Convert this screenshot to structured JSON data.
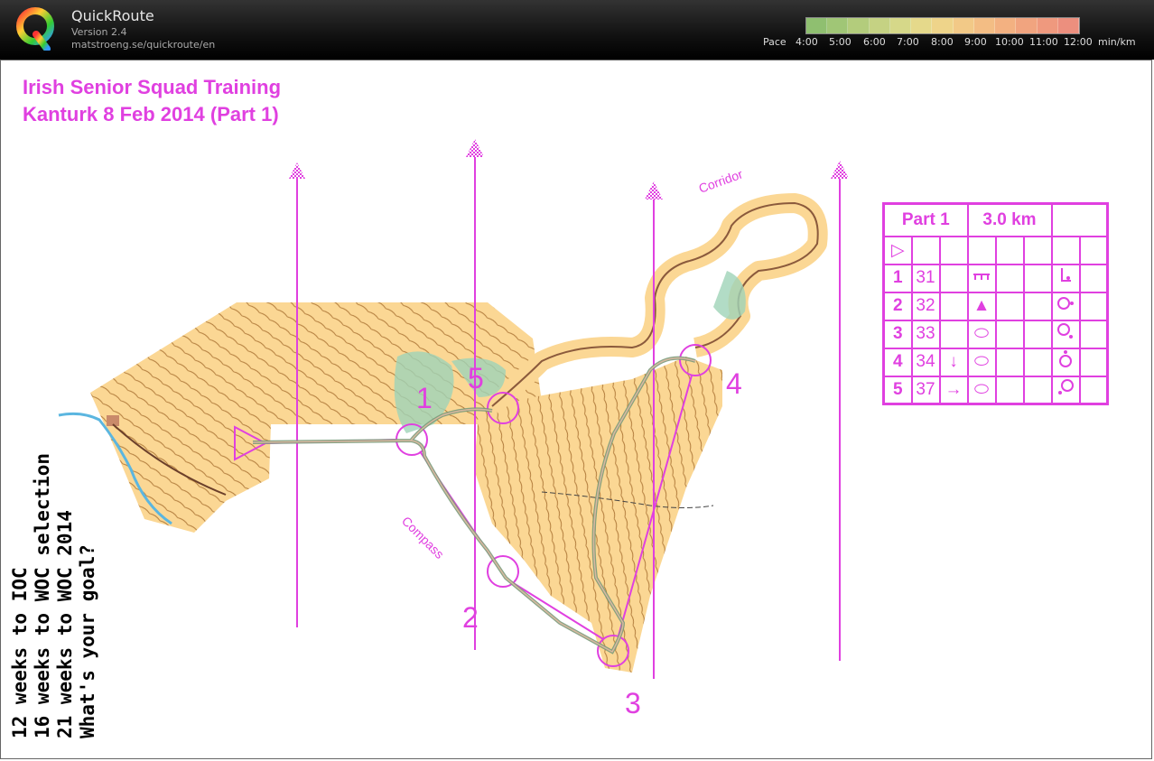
{
  "app": {
    "title": "QuickRoute",
    "version": "Version 2.4",
    "url": "matstroeng.se/quickroute/en",
    "logo_letter": "Q"
  },
  "pace_legend": {
    "label": "Pace",
    "ticks": [
      "4:00",
      "5:00",
      "6:00",
      "7:00",
      "8:00",
      "9:00",
      "10:00",
      "11:00",
      "12:00"
    ],
    "unit": "min/km",
    "colors": [
      "#8fbf70",
      "#a0c676",
      "#b3cc7c",
      "#c5d283",
      "#d6d889",
      "#e5d98b",
      "#eed48a",
      "#f2c987",
      "#f3bd84",
      "#f3b181",
      "#f1a47f",
      "#ef997e",
      "#ec8f7e"
    ]
  },
  "map": {
    "title_line1": "Irish Senior Squad Training",
    "title_line2": "Kanturk 8 Feb 2014 (Part 1)",
    "corridor_label": "Corridor",
    "compass_label": "Compass",
    "control_numbers": [
      "1",
      "2",
      "3",
      "4",
      "5"
    ],
    "course_color": "#e040e0",
    "terrain_color": "#fbd794"
  },
  "side_text": {
    "line1": "12 weeks to IOC",
    "line2": "16 weeks to WOC selection",
    "line3": "21 weeks to WOC 2014",
    "line4": "What's your goal?"
  },
  "description_sheet": {
    "name": "Part 1",
    "length": "3.0 km",
    "start_symbol": "▷",
    "controls": [
      {
        "num": "1",
        "code": "31",
        "arrow": "",
        "feature": "ruined-wall",
        "location": "corner"
      },
      {
        "num": "2",
        "code": "32",
        "arrow": "",
        "feature": "▲",
        "location": "east-side"
      },
      {
        "num": "3",
        "code": "33",
        "arrow": "",
        "feature": "⬭",
        "location": "south-east"
      },
      {
        "num": "4",
        "code": "34",
        "arrow": "↓",
        "feature": "⬭",
        "location": "north"
      },
      {
        "num": "5",
        "code": "37",
        "arrow": "→",
        "feature": "⬭",
        "location": "south-west"
      }
    ]
  }
}
